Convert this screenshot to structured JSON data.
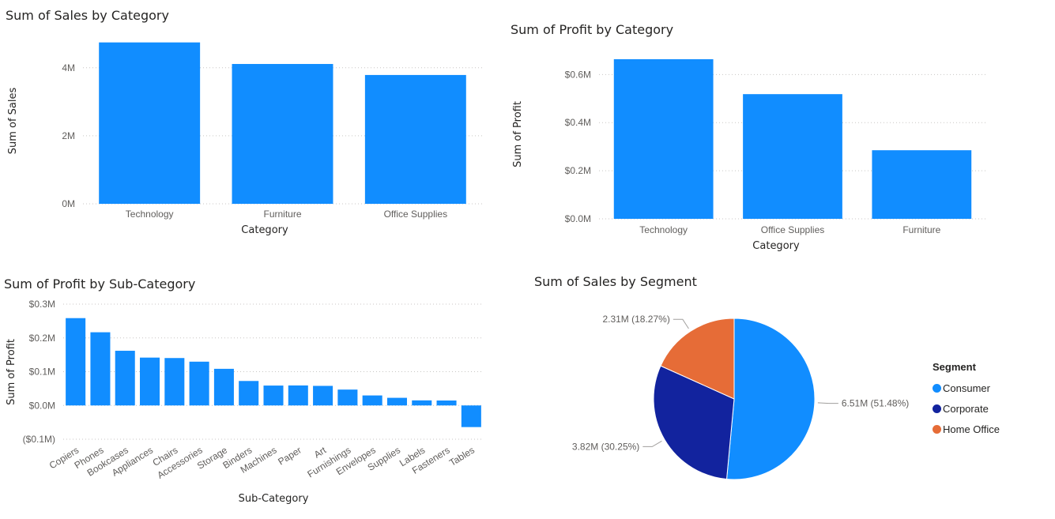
{
  "colors": {
    "bar": "#118DFF",
    "consumer": "#118DFF",
    "corporate": "#12239E",
    "home_office": "#E66C37"
  },
  "chart_data": [
    {
      "type": "bar",
      "title": "Sum of Sales by Category",
      "xlabel": "Category",
      "ylabel": "Sum of Sales",
      "categories": [
        "Technology",
        "Furniture",
        "Office Supplies"
      ],
      "values": [
        4744557,
        4110874,
        3787070
      ],
      "ylim": [
        0,
        4900000
      ],
      "yticks": [
        0,
        2000000,
        4000000
      ],
      "ytick_labels": [
        "0M",
        "2M",
        "4M"
      ],
      "grid": true
    },
    {
      "type": "bar",
      "title": "Sum of Profit by Category",
      "xlabel": "Category",
      "ylabel": "Sum of Profit",
      "categories": [
        "Technology",
        "Office Supplies",
        "Furniture"
      ],
      "values": [
        663779,
        518473,
        285205
      ],
      "ylim": [
        0,
        680000
      ],
      "yticks": [
        0,
        200000,
        400000,
        600000
      ],
      "ytick_labels": [
        "$0.0M",
        "$0.2M",
        "$0.4M",
        "$0.6M"
      ],
      "grid": true
    },
    {
      "type": "bar",
      "title": "Sum of Profit by Sub-Category",
      "xlabel": "Sub-Category",
      "ylabel": "Sum of Profit",
      "categories": [
        "Copiers",
        "Phones",
        "Bookcases",
        "Appliances",
        "Chairs",
        "Accessories",
        "Storage",
        "Binders",
        "Machines",
        "Paper",
        "Art",
        "Furnishings",
        "Envelopes",
        "Supplies",
        "Labels",
        "Fasteners",
        "Tables"
      ],
      "values": [
        258568,
        216717,
        161924,
        141681,
        140396,
        129626,
        108461,
        72449,
        58867,
        59207,
        57954,
        46968,
        29601,
        22583,
        15010,
        14622,
        -64083
      ],
      "ylim": [
        -100000,
        300000
      ],
      "yticks": [
        -100000,
        0,
        100000,
        200000,
        300000
      ],
      "ytick_labels": [
        "($0.1M)",
        "$0.0M",
        "$0.1M",
        "$0.2M",
        "$0.3M"
      ],
      "grid": true
    },
    {
      "type": "pie",
      "title": "Sum of Sales by Segment",
      "legend_title": "Segment",
      "legend_position": "right",
      "slices": [
        {
          "name": "Consumer",
          "value": 6.51,
          "percent": 51.48,
          "label": "6.51M (51.48%)"
        },
        {
          "name": "Corporate",
          "value": 3.82,
          "percent": 30.25,
          "label": "3.82M (30.25%)"
        },
        {
          "name": "Home Office",
          "value": 2.31,
          "percent": 18.27,
          "label": "2.31M (18.27%)"
        }
      ]
    }
  ]
}
